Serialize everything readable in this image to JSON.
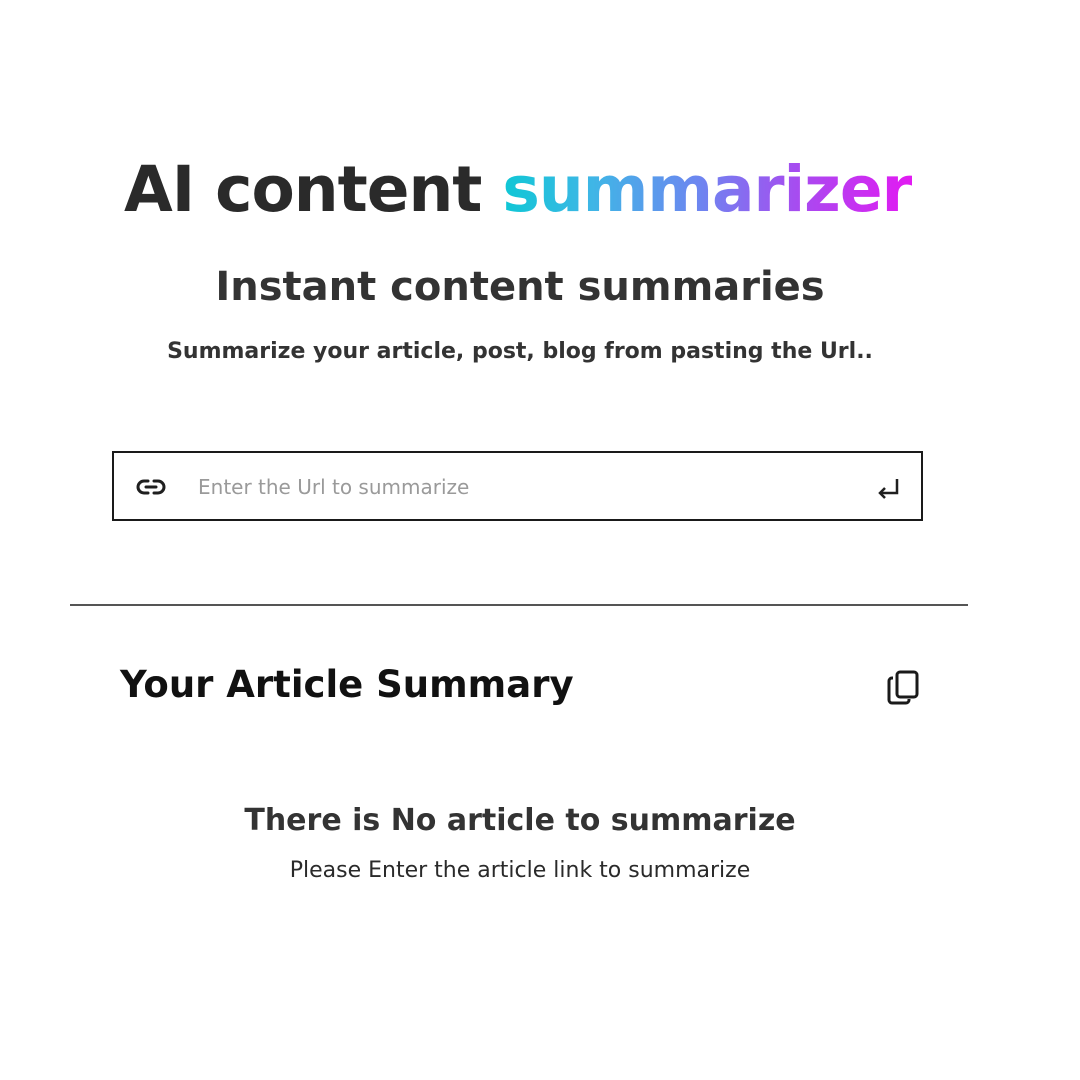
{
  "hero": {
    "title_plain": "AI content ",
    "title_accent": "summarizer"
  },
  "subtitle": "Instant content summaries",
  "tagline": "Summarize your article, post, blog from pasting the Url..",
  "url_input": {
    "placeholder": "Enter the Url to summarize",
    "value": "",
    "icon": "link-icon",
    "submit_icon": "enter-return-icon"
  },
  "summary": {
    "heading": "Your Article Summary",
    "copy_icon": "copy-icon",
    "empty_title": "There is No article to summarize",
    "empty_text": "Please Enter the article link to summarize"
  },
  "colors": {
    "text": "#2a2a2a",
    "accent_gradient": [
      "#0fc7d5",
      "#6d86f0",
      "#e21af2"
    ],
    "border": "#1a1a1a",
    "placeholder": "#9a9a9a"
  }
}
